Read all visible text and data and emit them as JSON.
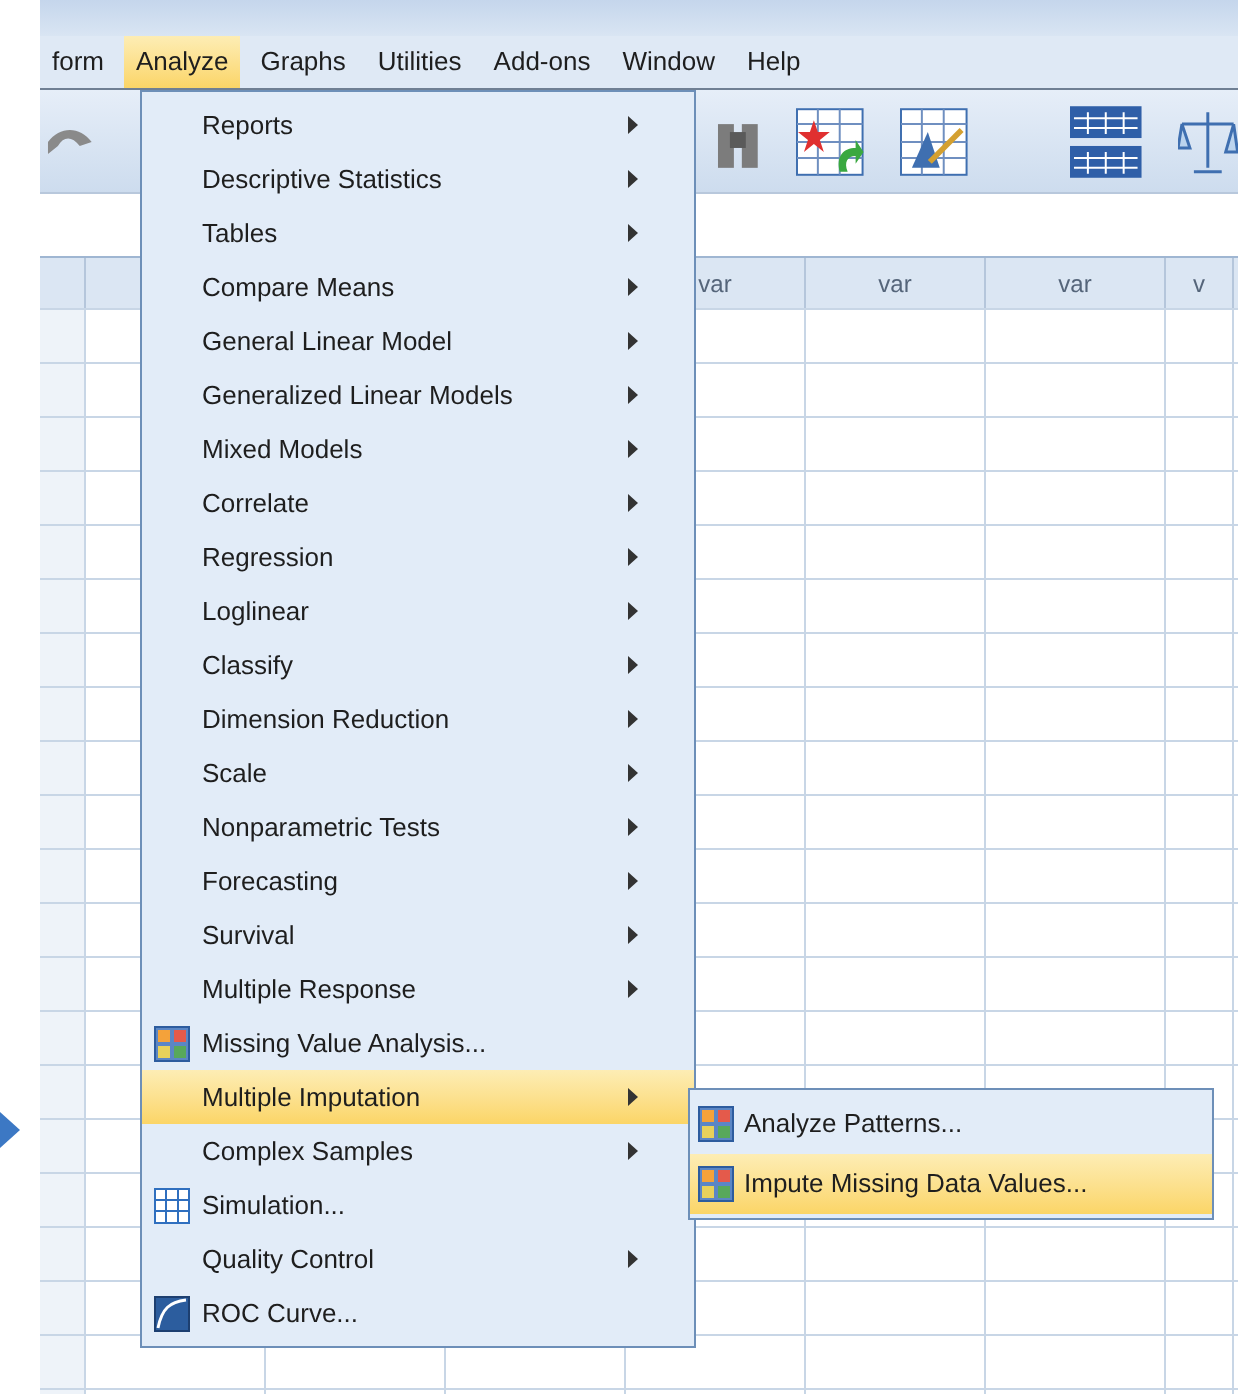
{
  "menubar": [
    {
      "label": "form",
      "selected": false
    },
    {
      "label": "Analyze",
      "selected": true
    },
    {
      "label": "Graphs",
      "selected": false
    },
    {
      "label": "Utilities",
      "selected": false
    },
    {
      "label": "Add-ons",
      "selected": false
    },
    {
      "label": "Window",
      "selected": false
    },
    {
      "label": "Help",
      "selected": false
    }
  ],
  "grid": {
    "columns": [
      "var",
      "var",
      "var",
      "v"
    ]
  },
  "menu": {
    "items": [
      {
        "label": "Reports",
        "kind": "submenu",
        "selected": false
      },
      {
        "label": "Descriptive Statistics",
        "kind": "submenu",
        "selected": false
      },
      {
        "label": "Tables",
        "kind": "submenu",
        "selected": false
      },
      {
        "label": "Compare Means",
        "kind": "submenu",
        "selected": false
      },
      {
        "label": "General Linear Model",
        "kind": "submenu",
        "selected": false
      },
      {
        "label": "Generalized Linear Models",
        "kind": "submenu",
        "selected": false
      },
      {
        "label": "Mixed Models",
        "kind": "submenu",
        "selected": false
      },
      {
        "label": "Correlate",
        "kind": "submenu",
        "selected": false
      },
      {
        "label": "Regression",
        "kind": "submenu",
        "selected": false
      },
      {
        "label": "Loglinear",
        "kind": "submenu",
        "selected": false
      },
      {
        "label": "Classify",
        "kind": "submenu",
        "selected": false
      },
      {
        "label": "Dimension Reduction",
        "kind": "submenu",
        "selected": false
      },
      {
        "label": "Scale",
        "kind": "submenu",
        "selected": false
      },
      {
        "label": "Nonparametric Tests",
        "kind": "submenu",
        "selected": false
      },
      {
        "label": "Forecasting",
        "kind": "submenu",
        "selected": false
      },
      {
        "label": "Survival",
        "kind": "submenu",
        "selected": false
      },
      {
        "label": "Multiple Response",
        "kind": "submenu",
        "selected": false
      },
      {
        "label": "Missing Value Analysis...",
        "kind": "command",
        "selected": false
      },
      {
        "label": "Multiple Imputation",
        "kind": "submenu",
        "selected": true
      },
      {
        "label": "Complex Samples",
        "kind": "submenu",
        "selected": false
      },
      {
        "label": "Simulation...",
        "kind": "command",
        "selected": false
      },
      {
        "label": "Quality Control",
        "kind": "submenu",
        "selected": false
      },
      {
        "label": "ROC Curve...",
        "kind": "command",
        "selected": false
      }
    ]
  },
  "submenu": {
    "items": [
      {
        "label": "Analyze Patterns...",
        "selected": false
      },
      {
        "label": "Impute Missing Data Values...",
        "selected": true
      }
    ]
  }
}
